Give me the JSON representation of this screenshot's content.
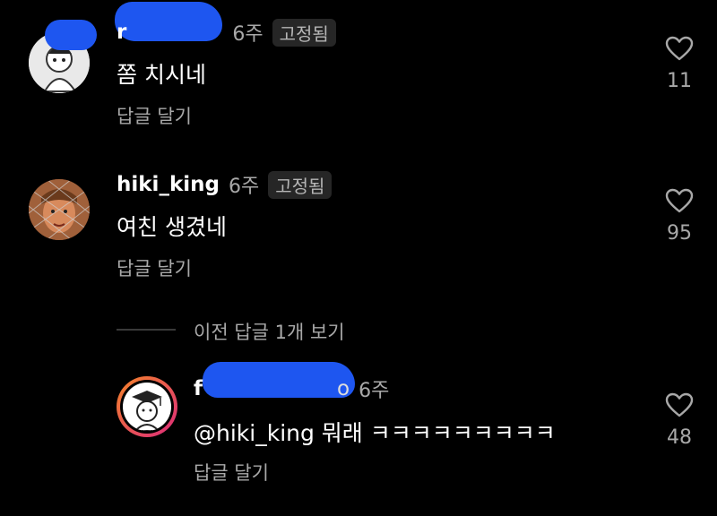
{
  "comments": [
    {
      "username": "r",
      "time": "6주",
      "pinned": "고정됨",
      "text": "쫌 치시네",
      "reply": "답글 달기",
      "likes": "11",
      "avatar_icon": "anime-character-avatar"
    },
    {
      "username": "hiki_king",
      "time": "6주",
      "pinned": "고정됨",
      "text": "여친 생겼네",
      "reply": "답글 달기",
      "likes": "95",
      "avatar_icon": "fence-face-avatar"
    }
  ],
  "view_previous": "이전 답글 1개 보기",
  "reply": {
    "username": "f",
    "username_end": "o",
    "time": "6주",
    "text": "@hiki_king 뭐래 ㅋㅋㅋㅋㅋㅋㅋㅋㅋ",
    "reply": "답글 달기",
    "likes": "48",
    "avatar_icon": "graduation-cap-avatar"
  },
  "colors": {
    "background": "#000000",
    "secondary_text": "#a8a8a8",
    "redaction": "#1e56f0",
    "story_ring_start": "#f58529",
    "story_ring_end": "#dd2a7b"
  }
}
